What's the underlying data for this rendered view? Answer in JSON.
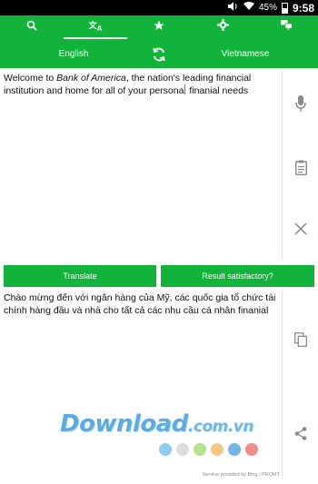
{
  "status_bar": {
    "battery": "45%",
    "time": "9:58"
  },
  "toolbar": {
    "tabs": [
      {
        "icon": "search-icon"
      },
      {
        "icon": "translate-icon",
        "glyph_top": "文",
        "glyph_bottom": "A"
      },
      {
        "icon": "star-icon"
      },
      {
        "icon": "gear-icon"
      },
      {
        "icon": "chat-icon"
      }
    ],
    "source_language": "English",
    "target_language": "Vietnamese"
  },
  "input": {
    "text_before": "Welcome to ",
    "text_italic": "Bank of America",
    "text_mid": ", the nation's leading financial institution and home for all of your persona",
    "text_after": " finanial needs"
  },
  "buttons": {
    "translate": "Translate",
    "satisfied": "Result satisfactory?"
  },
  "output": {
    "text": "Chào mừng đến với ngân hàng của Mỹ, các quốc gia tổ chức tài chính hàng đầu và nhà cho tất cả các nhu cầu cá nhân finanial"
  },
  "watermark": {
    "main": "Download",
    "suffix": ".com.vn"
  },
  "credit": "Service provided by Bing / PROMT",
  "colors": {
    "accent": "#12b33a",
    "dots": [
      "#8fcdf0",
      "#dcdcdc",
      "#b7e08f",
      "#f7c67f",
      "#72b6e8",
      "#f08c8c"
    ]
  }
}
